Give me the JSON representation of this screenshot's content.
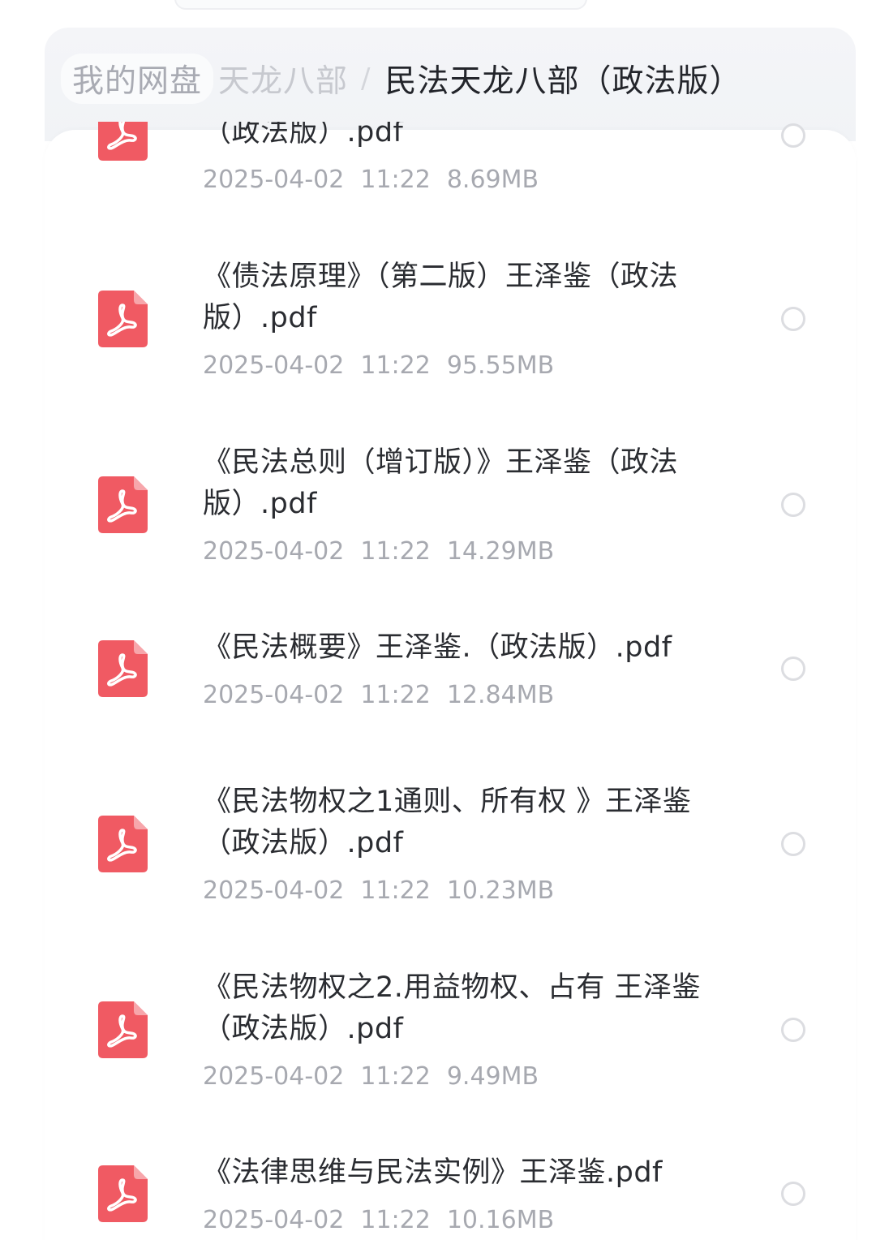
{
  "breadcrumb": {
    "root": "我的网盘",
    "parent": "天龙八部",
    "separator": "/",
    "current": "民法天龙八部（政法版）"
  },
  "colors": {
    "pdf_red": "#f05a63",
    "title_text": "#2a2c31",
    "meta_text": "#a7a9b0"
  },
  "files": [
    {
      "title": "（政法版）.pdf",
      "date": "2025-04-02",
      "time": "11:22",
      "size": "8.69MB",
      "icon": "pdf-icon"
    },
    {
      "title": "《债法原理》（第二版）王泽鉴（政法版）.pdf",
      "date": "2025-04-02",
      "time": "11:22",
      "size": "95.55MB",
      "icon": "pdf-icon"
    },
    {
      "title": "《民法总则（增订版）》王泽鉴（政法版）.pdf",
      "date": "2025-04-02",
      "time": "11:22",
      "size": "14.29MB",
      "icon": "pdf-icon"
    },
    {
      "title": "《民法概要》王泽鉴.（政法版）.pdf",
      "date": "2025-04-02",
      "time": "11:22",
      "size": "12.84MB",
      "icon": "pdf-icon"
    },
    {
      "title": "《民法物权之1通则、所有权 》王泽鉴（政法版）.pdf",
      "date": "2025-04-02",
      "time": "11:22",
      "size": "10.23MB",
      "icon": "pdf-icon"
    },
    {
      "title": "《民法物权之2.用益物权、占有 王泽鉴（政法版）.pdf",
      "date": "2025-04-02",
      "time": "11:22",
      "size": "9.49MB",
      "icon": "pdf-icon"
    },
    {
      "title": "《法律思维与民法实例》王泽鉴.pdf",
      "date": "2025-04-02",
      "time": "11:22",
      "size": "10.16MB",
      "icon": "pdf-icon"
    }
  ]
}
